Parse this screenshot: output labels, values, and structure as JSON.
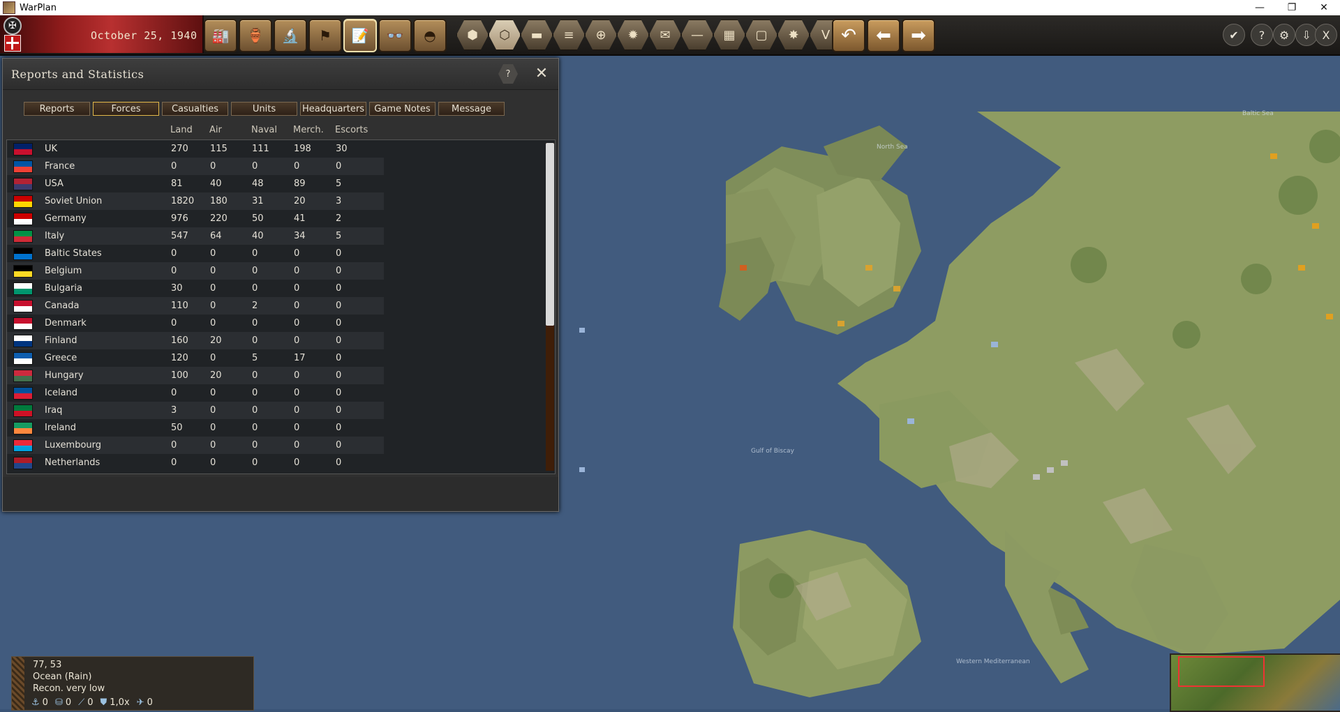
{
  "window": {
    "title": "WarPlan",
    "minimize": "—",
    "restore": "❐",
    "close": "✕"
  },
  "topbar": {
    "date": "October 25, 1940",
    "buttons": [
      {
        "name": "factory-icon",
        "glyph": "🏭"
      },
      {
        "name": "supply-icon",
        "glyph": "🏺"
      },
      {
        "name": "microscope-icon",
        "glyph": "🔬"
      },
      {
        "name": "flag-icon",
        "glyph": "⚑"
      },
      {
        "name": "report-icon",
        "glyph": "📝"
      },
      {
        "name": "binoculars-icon",
        "glyph": "👓"
      },
      {
        "name": "helmet-icon",
        "glyph": "◓"
      }
    ],
    "hexbuttons": [
      {
        "name": "hex-terrain-icon",
        "glyph": "⬢"
      },
      {
        "name": "hex-grid-icon",
        "glyph": "⬡"
      },
      {
        "name": "hex-tank-icon",
        "glyph": "▬"
      },
      {
        "name": "hex-stack-icon",
        "glyph": "≡"
      },
      {
        "name": "hex-target-icon",
        "glyph": "⊕"
      },
      {
        "name": "hex-sun-icon",
        "glyph": "✹"
      },
      {
        "name": "hex-mail-icon",
        "glyph": "✉"
      },
      {
        "name": "hex-line-icon",
        "glyph": "—"
      },
      {
        "name": "hex-squares-icon",
        "glyph": "▦"
      },
      {
        "name": "hex-frame-icon",
        "glyph": "▢"
      },
      {
        "name": "hex-explosion-icon",
        "glyph": "✸"
      },
      {
        "name": "hex-victory-icon",
        "glyph": "V"
      }
    ],
    "arrows": [
      {
        "name": "undo-icon",
        "glyph": "↶"
      },
      {
        "name": "back-arrow-icon",
        "glyph": "⬅"
      },
      {
        "name": "forward-arrow-icon",
        "glyph": "➡"
      }
    ],
    "right": [
      {
        "name": "check-icon",
        "glyph": "✔"
      },
      {
        "name": "help-icon",
        "glyph": "?"
      },
      {
        "name": "settings-icon",
        "glyph": "⚙"
      },
      {
        "name": "save-icon",
        "glyph": "⇩"
      },
      {
        "name": "exit-icon",
        "glyph": "X"
      }
    ]
  },
  "panel": {
    "title": "Reports and Statistics",
    "help": "?",
    "close": "✕",
    "tabs": [
      "Reports",
      "Forces",
      "Casualties",
      "Units",
      "Headquarters",
      "Game Notes",
      "Message"
    ],
    "active_tab": 1,
    "columns": [
      "Land",
      "Air",
      "Naval",
      "Merch.",
      "Escorts"
    ],
    "rows": [
      {
        "country": "UK",
        "land": "270",
        "air": "115",
        "naval": "111",
        "merch": "198",
        "escorts": "30"
      },
      {
        "country": "France",
        "land": "0",
        "air": "0",
        "naval": "0",
        "merch": "0",
        "escorts": "0"
      },
      {
        "country": "USA",
        "land": "81",
        "air": "40",
        "naval": "48",
        "merch": "89",
        "escorts": "5"
      },
      {
        "country": "Soviet Union",
        "land": "1820",
        "air": "180",
        "naval": "31",
        "merch": "20",
        "escorts": "3"
      },
      {
        "country": "Germany",
        "land": "976",
        "air": "220",
        "naval": "50",
        "merch": "41",
        "escorts": "2"
      },
      {
        "country": "Italy",
        "land": "547",
        "air": "64",
        "naval": "40",
        "merch": "34",
        "escorts": "5"
      },
      {
        "country": "Baltic States",
        "land": "0",
        "air": "0",
        "naval": "0",
        "merch": "0",
        "escorts": "0"
      },
      {
        "country": "Belgium",
        "land": "0",
        "air": "0",
        "naval": "0",
        "merch": "0",
        "escorts": "0"
      },
      {
        "country": "Bulgaria",
        "land": "30",
        "air": "0",
        "naval": "0",
        "merch": "0",
        "escorts": "0"
      },
      {
        "country": "Canada",
        "land": "110",
        "air": "0",
        "naval": "2",
        "merch": "0",
        "escorts": "0"
      },
      {
        "country": "Denmark",
        "land": "0",
        "air": "0",
        "naval": "0",
        "merch": "0",
        "escorts": "0"
      },
      {
        "country": "Finland",
        "land": "160",
        "air": "20",
        "naval": "0",
        "merch": "0",
        "escorts": "0"
      },
      {
        "country": "Greece",
        "land": "120",
        "air": "0",
        "naval": "5",
        "merch": "17",
        "escorts": "0"
      },
      {
        "country": "Hungary",
        "land": "100",
        "air": "20",
        "naval": "0",
        "merch": "0",
        "escorts": "0"
      },
      {
        "country": "Iceland",
        "land": "0",
        "air": "0",
        "naval": "0",
        "merch": "0",
        "escorts": "0"
      },
      {
        "country": "Iraq",
        "land": "3",
        "air": "0",
        "naval": "0",
        "merch": "0",
        "escorts": "0"
      },
      {
        "country": "Ireland",
        "land": "50",
        "air": "0",
        "naval": "0",
        "merch": "0",
        "escorts": "0"
      },
      {
        "country": "Luxembourg",
        "land": "0",
        "air": "0",
        "naval": "0",
        "merch": "0",
        "escorts": "0"
      },
      {
        "country": "Netherlands",
        "land": "0",
        "air": "0",
        "naval": "0",
        "merch": "0",
        "escorts": "0"
      }
    ],
    "flag_colors": [
      [
        "#012169",
        "#c8102e"
      ],
      [
        "#0055a4",
        "#ef4135"
      ],
      [
        "#b22234",
        "#3c3b6e"
      ],
      [
        "#cc0000",
        "#ffd700"
      ],
      [
        "#cc0000",
        "#ffffff"
      ],
      [
        "#009246",
        "#ce2b37"
      ],
      [
        "#000000",
        "#0072ce"
      ],
      [
        "#000000",
        "#fdda24"
      ],
      [
        "#ffffff",
        "#00966e"
      ],
      [
        "#c8102e",
        "#ffffff"
      ],
      [
        "#c8102e",
        "#ffffff"
      ],
      [
        "#ffffff",
        "#003580"
      ],
      [
        "#0d5eaf",
        "#ffffff"
      ],
      [
        "#cd2a3e",
        "#436f4d"
      ],
      [
        "#02529c",
        "#dc1e35"
      ],
      [
        "#007a3d",
        "#ce1126"
      ],
      [
        "#169b62",
        "#ff883e"
      ],
      [
        "#ed2939",
        "#00a1de"
      ],
      [
        "#ae1c28",
        "#21468b"
      ]
    ]
  },
  "map_labels": [
    "North Sea",
    "Baltic Sea",
    "Gulf of Biscay",
    "Western Mediterranean"
  ],
  "hexinfo": {
    "coords": "77, 53",
    "terrain": "Ocean (Rain)",
    "recon": "Recon. very low",
    "stats": [
      {
        "icon": "anchor-icon",
        "glyph": "⚓",
        "value": "0"
      },
      {
        "icon": "supply-icon",
        "glyph": "⛁",
        "value": "0"
      },
      {
        "icon": "artillery-icon",
        "glyph": "⟋",
        "value": "0"
      },
      {
        "icon": "shield-icon",
        "glyph": "⛊",
        "value": "1,0x"
      },
      {
        "icon": "plane-icon",
        "glyph": "✈",
        "value": "0"
      }
    ]
  }
}
